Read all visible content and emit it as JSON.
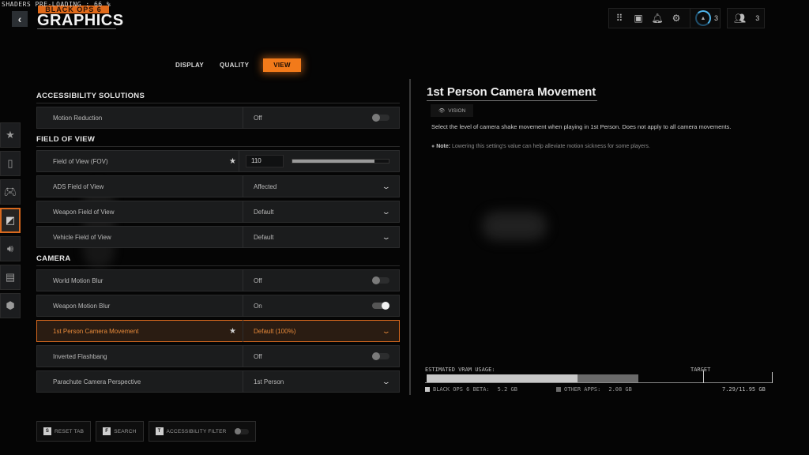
{
  "header": {
    "preload_status": "SHADERS PRE-LOADING : 66 %",
    "brand": "BLACK OPS 6",
    "title": "GRAPHICS",
    "back_icon": "chevron-left-icon"
  },
  "toolbar": {
    "icons": [
      "grid-icon",
      "store-icon",
      "bell-icon",
      "gear-icon"
    ],
    "level_icon": "rank-icon",
    "level": "3",
    "party_icon": "party-icon",
    "party_count": "3"
  },
  "tabs": [
    {
      "label": "DISPLAY",
      "active": false
    },
    {
      "label": "QUALITY",
      "active": false
    },
    {
      "label": "VIEW",
      "active": true
    }
  ],
  "sidebar": {
    "items": [
      {
        "icon": "star-icon",
        "active": false
      },
      {
        "icon": "mouse-icon",
        "active": false
      },
      {
        "icon": "controller-icon",
        "active": false
      },
      {
        "icon": "graphics-icon",
        "active": true
      },
      {
        "icon": "speaker-icon",
        "active": false
      },
      {
        "icon": "interface-icon",
        "active": false
      },
      {
        "icon": "network-icon",
        "active": false
      }
    ]
  },
  "sections": {
    "accessibility": {
      "title": "ACCESSIBILITY SOLUTIONS",
      "rows": [
        {
          "label": "Motion Reduction",
          "value": "Off",
          "control": "toggle",
          "on": false
        }
      ]
    },
    "fov": {
      "title": "FIELD OF VIEW",
      "fov_row": {
        "label": "Field of View (FOV)",
        "value": "110",
        "slider_fraction": 0.85,
        "starred": true
      },
      "rows": [
        {
          "label": "ADS Field of View",
          "value": "Affected",
          "control": "dropdown"
        },
        {
          "label": "Weapon Field of View",
          "value": "Default",
          "control": "dropdown"
        },
        {
          "label": "Vehicle Field of View",
          "value": "Default",
          "control": "dropdown"
        }
      ]
    },
    "camera": {
      "title": "CAMERA",
      "rows": [
        {
          "label": "World Motion Blur",
          "value": "Off",
          "control": "toggle",
          "on": false
        },
        {
          "label": "Weapon Motion Blur",
          "value": "On",
          "control": "toggle",
          "on": true
        },
        {
          "label": "1st Person Camera Movement",
          "value": "Default (100%)",
          "control": "dropdown",
          "selected": true,
          "starred": true
        },
        {
          "label": "Inverted Flashbang",
          "value": "Off",
          "control": "toggle",
          "on": false
        },
        {
          "label": "Parachute Camera Perspective",
          "value": "1st Person",
          "control": "dropdown"
        }
      ]
    }
  },
  "detail": {
    "title": "1st Person Camera Movement",
    "tag_icon": "eye-icon",
    "tag": "VISION",
    "description": "Select the level of camera shake movement when playing in 1st Person. Does not apply to all camera movements.",
    "note_label": "Note:",
    "note": " Lowering this setting's value can help alleviate motion sickness for some players."
  },
  "vram": {
    "label": "ESTIMATED VRAM USAGE:",
    "target_label": "TARGET",
    "game_label": "BLACK OPS 6 BETA:",
    "game_value": "5.2 GB",
    "other_label": "OTHER APPS:",
    "other_value": "2.08 GB",
    "total": "7.29/11.95 GB",
    "game_gb": 5.2,
    "other_gb": 2.08,
    "capacity_gb": 11.95,
    "target_fraction": 0.8,
    "colors": {
      "game": "#c8c8c8",
      "other": "#6a6a6a"
    }
  },
  "bottom": {
    "reset": {
      "key": "S",
      "label": "RESET TAB"
    },
    "search": {
      "key": "F",
      "label": "SEARCH"
    },
    "filter": {
      "key": "T",
      "label": "ACCESSIBILITY FILTER",
      "on": false
    }
  },
  "colors": {
    "accent": "#f27a1a"
  }
}
